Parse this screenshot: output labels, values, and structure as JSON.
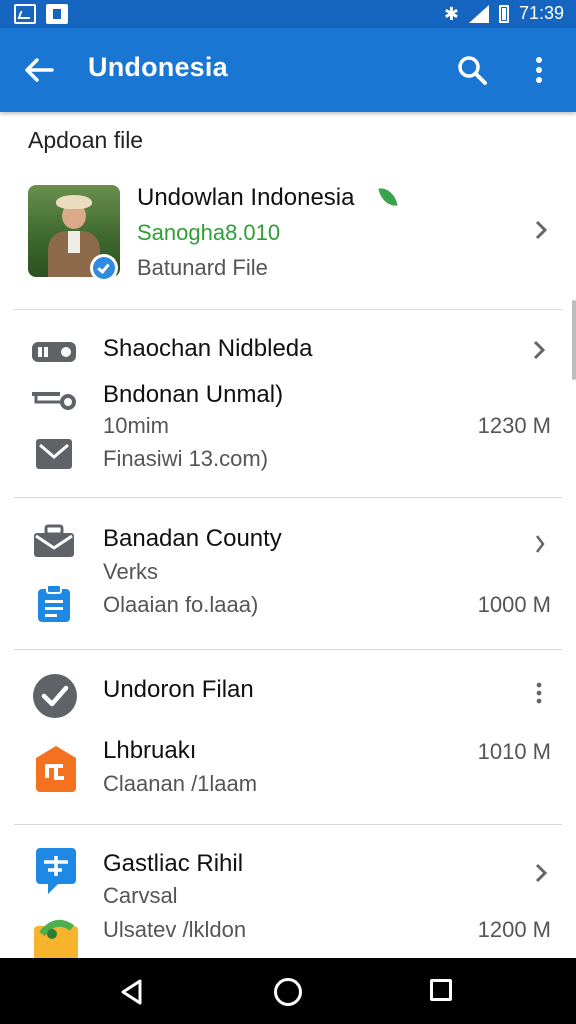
{
  "status_bar": {
    "time": "71:39",
    "icons": [
      "image-icon",
      "file-icon",
      "bluetooth-icon",
      "signal-icon",
      "battery-icon"
    ],
    "color": "#1565c0"
  },
  "app_bar": {
    "title": "Undonesia",
    "color": "#1976d2",
    "icons": [
      "back-arrow-icon",
      "search-icon",
      "more-vert-icon"
    ]
  },
  "section_header": "Apdoan file",
  "profile": {
    "name": "Undowlan Indonesia",
    "subtitle": "Sanogha8.010",
    "meta": "Batunard File",
    "accent": "#2e9e37"
  },
  "groups": [
    {
      "title": "Shaochan Nidbleda",
      "items": [
        {
          "title": "Bndonan Unmal)",
          "sub": "10mim",
          "size": "1230 M"
        },
        {
          "title": "",
          "sub": "Finasiwi 13.com)",
          "size": ""
        }
      ]
    },
    {
      "title": "Banadan County",
      "items": [
        {
          "title": "",
          "sub": "Verks",
          "size": ""
        },
        {
          "title": "",
          "sub": "Olaaian fo.laaa)",
          "size": "1000 M"
        }
      ]
    },
    {
      "title": "Undoron Filan",
      "items": [
        {
          "title": "Lhbruakı",
          "sub": "Claanan /1laam",
          "size": "1010 M"
        }
      ]
    },
    {
      "title": "Gastliac Rihil",
      "items": [
        {
          "title": "",
          "sub": "Carvsal",
          "size": ""
        },
        {
          "title": "",
          "sub": "Ulsatev /lkldon",
          "size": "1200 M"
        }
      ]
    }
  ],
  "icon_colors": {
    "gray": "#5f6368",
    "blue": "#1e88e5",
    "orange": "#f4711f",
    "yellow": "#f6b32b",
    "green": "#4caf50"
  }
}
